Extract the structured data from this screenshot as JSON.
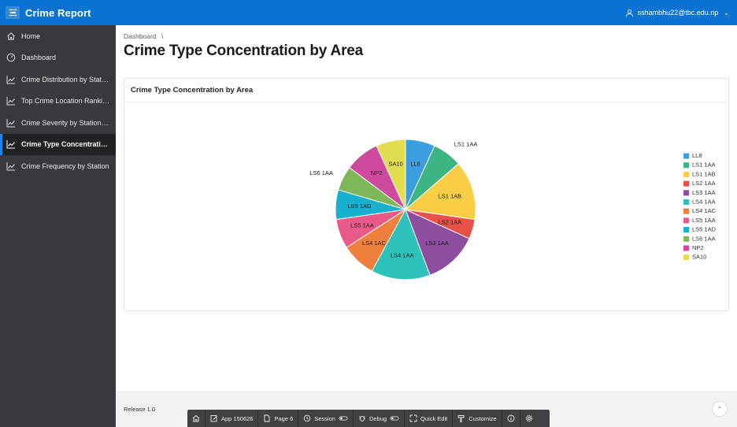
{
  "header": {
    "app_title": "Crime Report",
    "user": "sshambhu22@tbc.edu.np",
    "menu_icon": "hamburger-icon",
    "user_icon": "user-icon"
  },
  "sidebar": {
    "items": [
      {
        "label": "Home",
        "icon": "home-icon",
        "active": false
      },
      {
        "label": "Dashboard",
        "icon": "dashboard-icon",
        "active": false
      },
      {
        "label": "Crime Distribution by Station",
        "icon": "line-chart-icon",
        "active": false
      },
      {
        "label": "Top Crime Location Ranking",
        "icon": "line-chart-icon",
        "active": false
      },
      {
        "label": "Crime Severity by Station/R...",
        "icon": "line-chart-icon",
        "active": false
      },
      {
        "label": "Crime Type Concentration by Area",
        "icon": "line-chart-icon",
        "active": true
      },
      {
        "label": "Crime Frequency by Station",
        "icon": "line-chart-icon",
        "active": false
      }
    ]
  },
  "breadcrumb": "Dashboard",
  "breadcrumb_sep": "\\",
  "page_title": "Crime Type Concentration by Area",
  "region_title": "Crime Type Concentration by Area",
  "chart_data": {
    "type": "pie",
    "title": "",
    "legend_position": "right",
    "categories": [
      "LL8",
      "LS1 1AA",
      "LS1 1AB",
      "LS2 1AA",
      "LS3 1AA",
      "LS4 1AA",
      "LS4 1AC",
      "LS5 1AA",
      "LS5 1AD",
      "LS6 1AA",
      "NP2",
      "SA10"
    ],
    "values": [
      6,
      6,
      12,
      4,
      11,
      12,
      7,
      6,
      6,
      5,
      7,
      6
    ],
    "colors": [
      "#3a9ee0",
      "#3db582",
      "#fccd46",
      "#e8504a",
      "#8d4ea0",
      "#2ec2bc",
      "#ee7f3c",
      "#e85a8a",
      "#17b0cf",
      "#7cb85a",
      "#cf4a9f",
      "#e2de4f"
    ],
    "outside_labels": [
      "LS1 1AA",
      "LS6 1AA"
    ]
  },
  "footer": {
    "release": "Release 1.0",
    "scroll_top_icon": "chevron-up-icon"
  },
  "devbar": {
    "items": [
      {
        "label": "",
        "icon": "home-icon"
      },
      {
        "label": "App 150626",
        "icon": "edit-icon"
      },
      {
        "label": "Page 6",
        "icon": "page-edit-icon"
      },
      {
        "label": "Session",
        "icon": "session-icon"
      },
      {
        "label": "Debug",
        "icon": "debug-icon"
      },
      {
        "label": "Quick Edit",
        "icon": "quick-edit-icon"
      },
      {
        "label": "Customize",
        "icon": "customize-icon"
      },
      {
        "label": "",
        "icon": "info-icon"
      },
      {
        "label": "",
        "icon": "gear-icon"
      }
    ]
  }
}
